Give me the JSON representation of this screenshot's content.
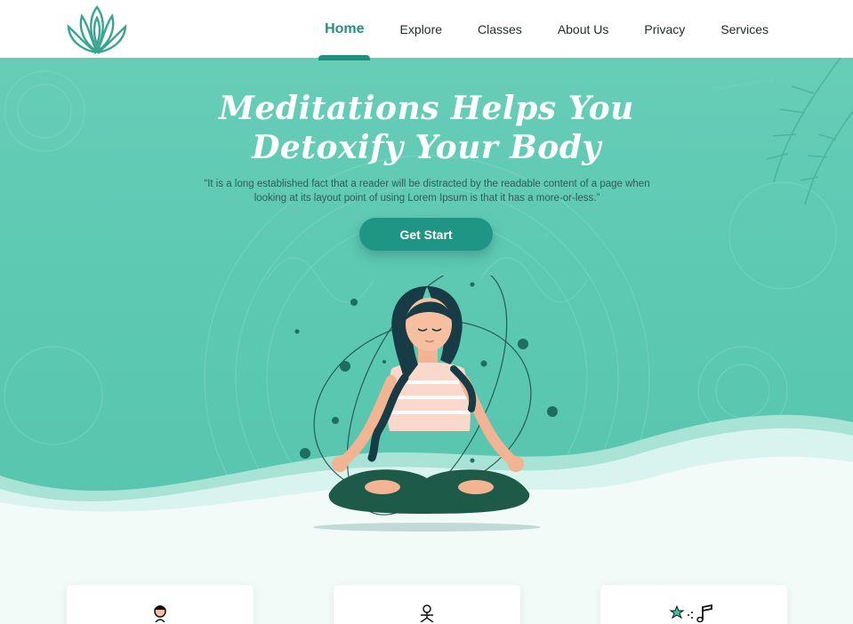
{
  "brand": {
    "logo_icon": "lotus-logo-icon",
    "accent_color": "#1f8f7c"
  },
  "nav": {
    "items": [
      {
        "label": "Home",
        "active": true
      },
      {
        "label": "Explore",
        "active": false
      },
      {
        "label": "Classes",
        "active": false
      },
      {
        "label": "About Us",
        "active": false
      },
      {
        "label": "Privacy",
        "active": false
      },
      {
        "label": "Services",
        "active": false
      }
    ]
  },
  "hero": {
    "title_line1": "Meditations Helps You",
    "title_line2": "Detoxify Your Body",
    "description": "“It is a long established fact that a reader will be distracted by the readable content of a page when looking at its layout point of using Lorem Ipsum is that it has a more-or-less.”",
    "cta_label": "Get Start",
    "background_color": "#5bc8b1",
    "illustration": "meditating-woman-illustration"
  },
  "cards": [
    {
      "icon": "meditating-person-icon"
    },
    {
      "icon": "yoga-pose-icon"
    },
    {
      "icon": "star-music-note-icon"
    }
  ]
}
